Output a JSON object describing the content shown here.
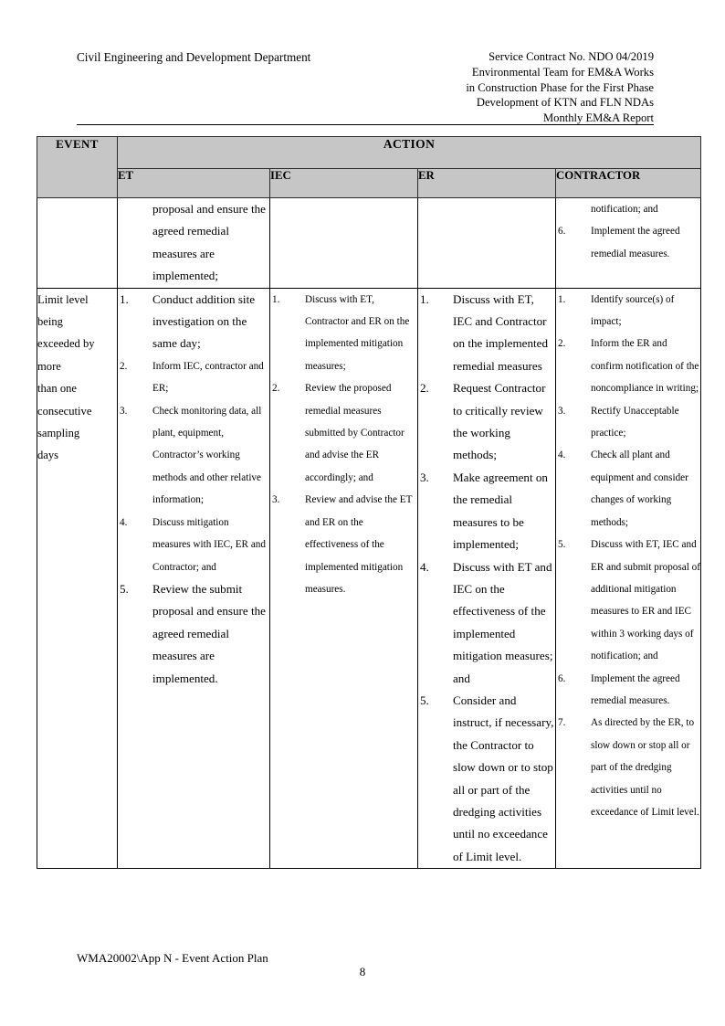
{
  "header": {
    "left_title": "Civil Engineering and Development Department",
    "right_lines": [
      "Service Contract No. NDO 04/2019",
      "Environmental Team for EM&A Works",
      "in Construction Phase for the First Phase",
      "Development of KTN and FLN NDAs",
      "Monthly EM&A Report"
    ]
  },
  "table": {
    "columns": {
      "event": "EVENT",
      "action": "ACTION",
      "et": "ET",
      "iec": "IEC",
      "er": "ER",
      "contractor": "CONTRACTOR"
    },
    "rows": [
      {
        "event_lines": [],
        "et": {
          "lead": "proposal and ensure the agreed remedial measures are implemented;",
          "items": []
        },
        "iec": {
          "lead": "",
          "items": []
        },
        "er": {
          "lead": "",
          "items": []
        },
        "contractor": {
          "lead": "notification; and",
          "items": [
            {
              "num": "6.",
              "text": "Implement the agreed remedial measures."
            }
          ]
        }
      },
      {
        "event_lines": [
          "Limit level",
          "being",
          "exceeded by",
          "more",
          "than one",
          "consecutive",
          "sampling",
          "days"
        ],
        "et": {
          "lead": "",
          "items": [
            {
              "num": "1.",
              "text": "Conduct addition site investigation on the same day;",
              "size": "lg"
            },
            {
              "num": "2.",
              "text": "Inform IEC, contractor and ER;",
              "size": "sm"
            },
            {
              "num": "3.",
              "text": "Check monitoring data, all plant, equipment, Contractor’s working methods and other relative information;",
              "size": "sm"
            },
            {
              "num": "4.",
              "text": "Discuss mitigation measures with IEC, ER and Contractor; and",
              "size": "sm"
            },
            {
              "num": "5.",
              "text": "Review the submit proposal and ensure the agreed remedial measures are implemented.",
              "size": "lg"
            }
          ]
        },
        "iec": {
          "lead": "",
          "items": [
            {
              "num": "1.",
              "text": "Discuss with ET, Contractor and ER on the implemented mitigation measures;",
              "size": "sm"
            },
            {
              "num": "2.",
              "text": "Review the proposed remedial measures submitted by Contractor and advise the ER accordingly; and",
              "size": "sm"
            },
            {
              "num": "3.",
              "text": "Review and advise the ET and ER on the effectiveness of the implemented mitigation measures.",
              "size": "sm"
            }
          ]
        },
        "er": {
          "lead": "",
          "items": [
            {
              "num": "1.",
              "text": "Discuss with ET, IEC and Contractor on the implemented remedial measures",
              "size": "lg"
            },
            {
              "num": "2.",
              "text": "Request Contractor to critically review the working methods;",
              "size": "lg"
            },
            {
              "num": "3.",
              "text": "Make agreement on the remedial measures to be implemented;",
              "size": "lg"
            },
            {
              "num": "4.",
              "text": "Discuss with ET and IEC on the effectiveness of the implemented mitigation measures; and",
              "size": "lg"
            },
            {
              "num": "5.",
              "text": "Consider and instruct, if necessary, the Contractor to slow down or to stop all or part of the dredging activities until no exceedance of Limit level.",
              "size": "lg"
            }
          ]
        },
        "contractor": {
          "lead": "",
          "items": [
            {
              "num": "1.",
              "text": "Identify source(s) of impact;",
              "size": "sm"
            },
            {
              "num": "2.",
              "text": "Inform the ER and confirm notification of the noncompliance in writing;",
              "size": "sm"
            },
            {
              "num": "3.",
              "text": "Rectify Unacceptable practice;",
              "size": "sm"
            },
            {
              "num": "4.",
              "text": "Check all plant and equipment and consider changes of working methods;",
              "size": "sm"
            },
            {
              "num": "5.",
              "text": "Discuss with ET, IEC and ER and submit proposal of additional mitigation measures to ER and IEC within 3 working days of notification; and",
              "size": "sm"
            },
            {
              "num": "6.",
              "text": "Implement the agreed remedial measures.",
              "size": "sm"
            },
            {
              "num": "7.",
              "text": "As directed by the ER, to slow down or stop all or part of the dredging activities until no exceedance of Limit level.",
              "size": "sm"
            }
          ]
        }
      }
    ]
  },
  "footer": {
    "reference": "WMA20002\\App N - Event Action Plan",
    "page_number": "8"
  },
  "colors": {
    "header_fill": "#c6c6c6",
    "border": "#000000",
    "text": "#000000"
  }
}
